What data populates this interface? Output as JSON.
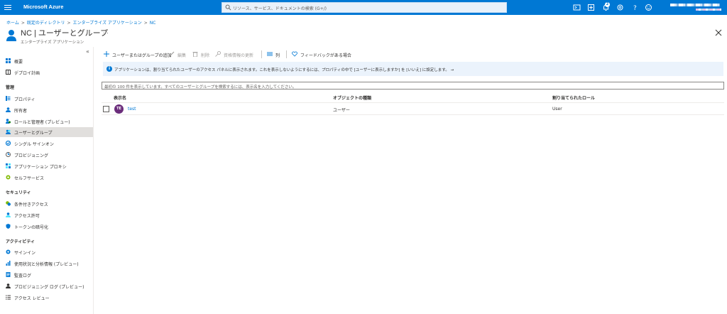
{
  "topbar": {
    "brand": "Microsoft Azure",
    "search_placeholder": "リソース、サービス、ドキュメントの検索 (G+/)",
    "notification_count": "2",
    "accent": "#0078d4"
  },
  "breadcrumb": [
    "ホーム",
    "既定のディレクトリ",
    "エンタープライズ アプリケーション",
    "NC"
  ],
  "header": {
    "title": "NC | ユーザーとグループ",
    "subtitle": "エンタープライズ アプリケーション",
    "more": "..."
  },
  "sidebar": {
    "collapse": "«",
    "top_items": [
      {
        "label": "概要",
        "icon": "grid-icon"
      },
      {
        "label": "デプロイ計画",
        "icon": "book-icon"
      }
    ],
    "sections": [
      {
        "heading": "管理",
        "items": [
          {
            "label": "プロパティ",
            "icon": "properties-icon"
          },
          {
            "label": "所有者",
            "icon": "owners-icon"
          },
          {
            "label": "ロールと管理者 (プレビュー)",
            "icon": "roles-icon"
          },
          {
            "label": "ユーザーとグループ",
            "icon": "users-groups-icon"
          },
          {
            "label": "シングル サインオン",
            "icon": "sso-icon"
          },
          {
            "label": "プロビジョニング",
            "icon": "provisioning-icon"
          },
          {
            "label": "アプリケーション プロキシ",
            "icon": "app-proxy-icon"
          },
          {
            "label": "セルフサービス",
            "icon": "self-service-icon"
          }
        ]
      },
      {
        "heading": "セキュリティ",
        "items": [
          {
            "label": "条件付きアクセス",
            "icon": "conditional-access-icon"
          },
          {
            "label": "アクセス許可",
            "icon": "permissions-icon"
          },
          {
            "label": "トークンの暗号化",
            "icon": "token-encryption-icon"
          }
        ]
      },
      {
        "heading": "アクティビティ",
        "items": [
          {
            "label": "サインイン",
            "icon": "signin-icon"
          },
          {
            "label": "使用状況と分析情報 (プレビュー)",
            "icon": "usage-insights-icon"
          },
          {
            "label": "監査ログ",
            "icon": "audit-log-icon"
          },
          {
            "label": "プロビジョニング ログ (プレビュー)",
            "icon": "provisioning-log-icon"
          },
          {
            "label": "アクセス レビュー",
            "icon": "access-review-icon"
          }
        ]
      }
    ]
  },
  "commands": {
    "add": "ユーザーまたはグループの追加",
    "edit": "編集",
    "remove": "削除",
    "update_credentials": "資格情報の更新",
    "columns": "列",
    "feedback": "フィードバックがある場合"
  },
  "banner": {
    "text": "アプリケーションは、割り当てられたユーザーのアクセス パネルに表示されます。これを表示しないようにするには、プロパティの中で [ユーザーに表示しますか] を [いいえ] に設定します。 →"
  },
  "filter": {
    "placeholder": "最初の 100 件を表示しています。すべてのユーザーとグループを検索するには、表示名を入力してください。"
  },
  "table": {
    "columns": [
      "表示名",
      "オブジェクトの種類",
      "割り当てられたロール"
    ],
    "rows": [
      {
        "initials": "TE",
        "name": "test",
        "type": "ユーザー",
        "role": "User"
      }
    ]
  }
}
